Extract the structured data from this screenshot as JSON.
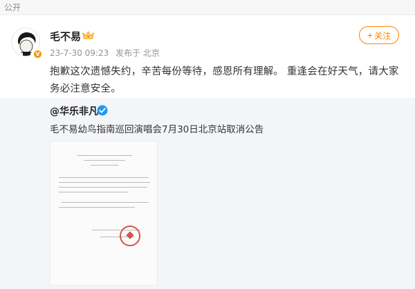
{
  "topbar": {
    "label": "公开"
  },
  "post": {
    "username": "毛不易",
    "timestamp": "23-7-30 09:23",
    "source": "发布于 北京",
    "follow_label": "关注",
    "text": "抱歉这次遗憾失约，辛苦每份等待，感恩所有理解。 重逢会在好天气，请大家务必注意安全。"
  },
  "repost": {
    "author": "@华乐非凡",
    "text": "毛不易幼鸟指南巡回演唱会7月30日北京站取消公告"
  },
  "colors": {
    "accent_orange": "#ff8200",
    "verified_blue": "#1d9bf0",
    "vip_gold": "#f39800",
    "repost_bg": "#f3f5f8"
  },
  "icons": {
    "vip": "crown-badge-icon",
    "verified": "verified-check-icon",
    "follow": "plus-icon"
  }
}
